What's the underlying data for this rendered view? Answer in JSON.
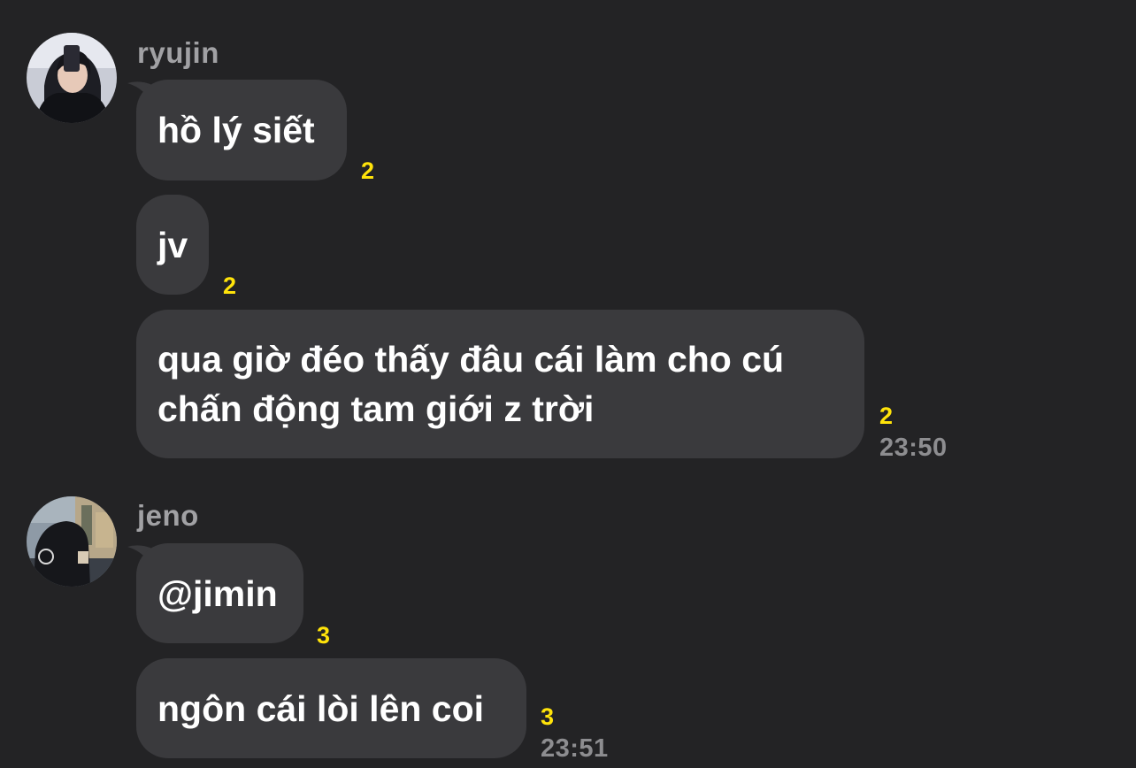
{
  "groups": [
    {
      "sender": "ryujin",
      "messages": [
        {
          "text": "hồ lý siết",
          "unread": "2"
        },
        {
          "text": "jv",
          "unread": "2"
        },
        {
          "text_lines": [
            "qua giờ đéo thấy đâu cái làm cho cú",
            "chấn động tam giới z trời"
          ],
          "unread": "2",
          "time": "23:50"
        }
      ]
    },
    {
      "sender": "jeno",
      "messages": [
        {
          "text": "@jimin",
          "unread": "3"
        },
        {
          "text": "ngôn cái lòi lên coi",
          "unread": "3",
          "time": "23:51"
        }
      ]
    }
  ],
  "colors": {
    "background": "#232325",
    "bubble": "#3a3a3d",
    "unread": "#ffe30a",
    "sender": "#a1a1a4",
    "time": "#8d8d90"
  }
}
